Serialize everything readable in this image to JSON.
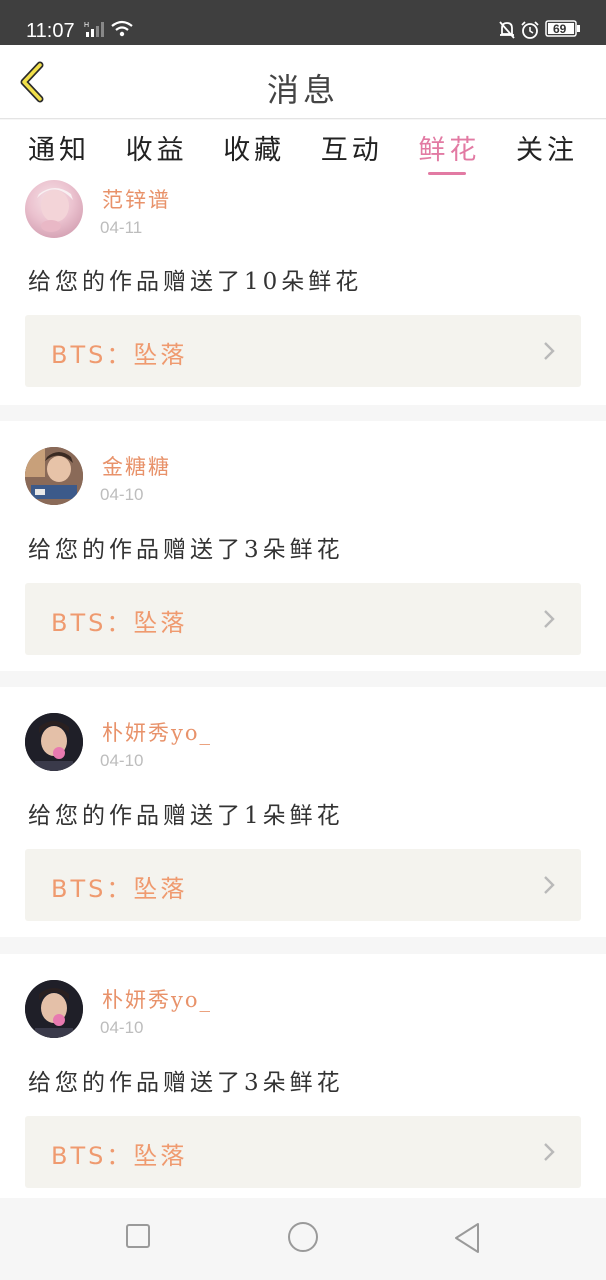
{
  "status_bar": {
    "time": "11:07",
    "battery": "69"
  },
  "header": {
    "title": "消息"
  },
  "tabs": [
    {
      "label": "通知"
    },
    {
      "label": "收益"
    },
    {
      "label": "收藏"
    },
    {
      "label": "互动"
    },
    {
      "label": "鲜花"
    },
    {
      "label": "关注"
    }
  ],
  "active_tab": "鲜花",
  "items": [
    {
      "user": "范锌谱",
      "date": "04-11",
      "message": "给您的作品赠送了10朵鲜花",
      "work": "BTS：坠落"
    },
    {
      "user": "金糖糖",
      "date": "04-10",
      "message": "给您的作品赠送了3朵鲜花",
      "work": "BTS：坠落"
    },
    {
      "user": "朴妍秀yo_",
      "date": "04-10",
      "message": "给您的作品赠送了1朵鲜花",
      "work": "BTS：坠落"
    },
    {
      "user": "朴妍秀yo_",
      "date": "04-10",
      "message": "给您的作品赠送了3朵鲜花",
      "work": "BTS：坠落"
    }
  ],
  "colors": {
    "accent_pink": "#e27aa3",
    "username_orange": "#e8926a",
    "work_orange": "#ef9a6f",
    "back_yellow": "#f2e04a"
  }
}
